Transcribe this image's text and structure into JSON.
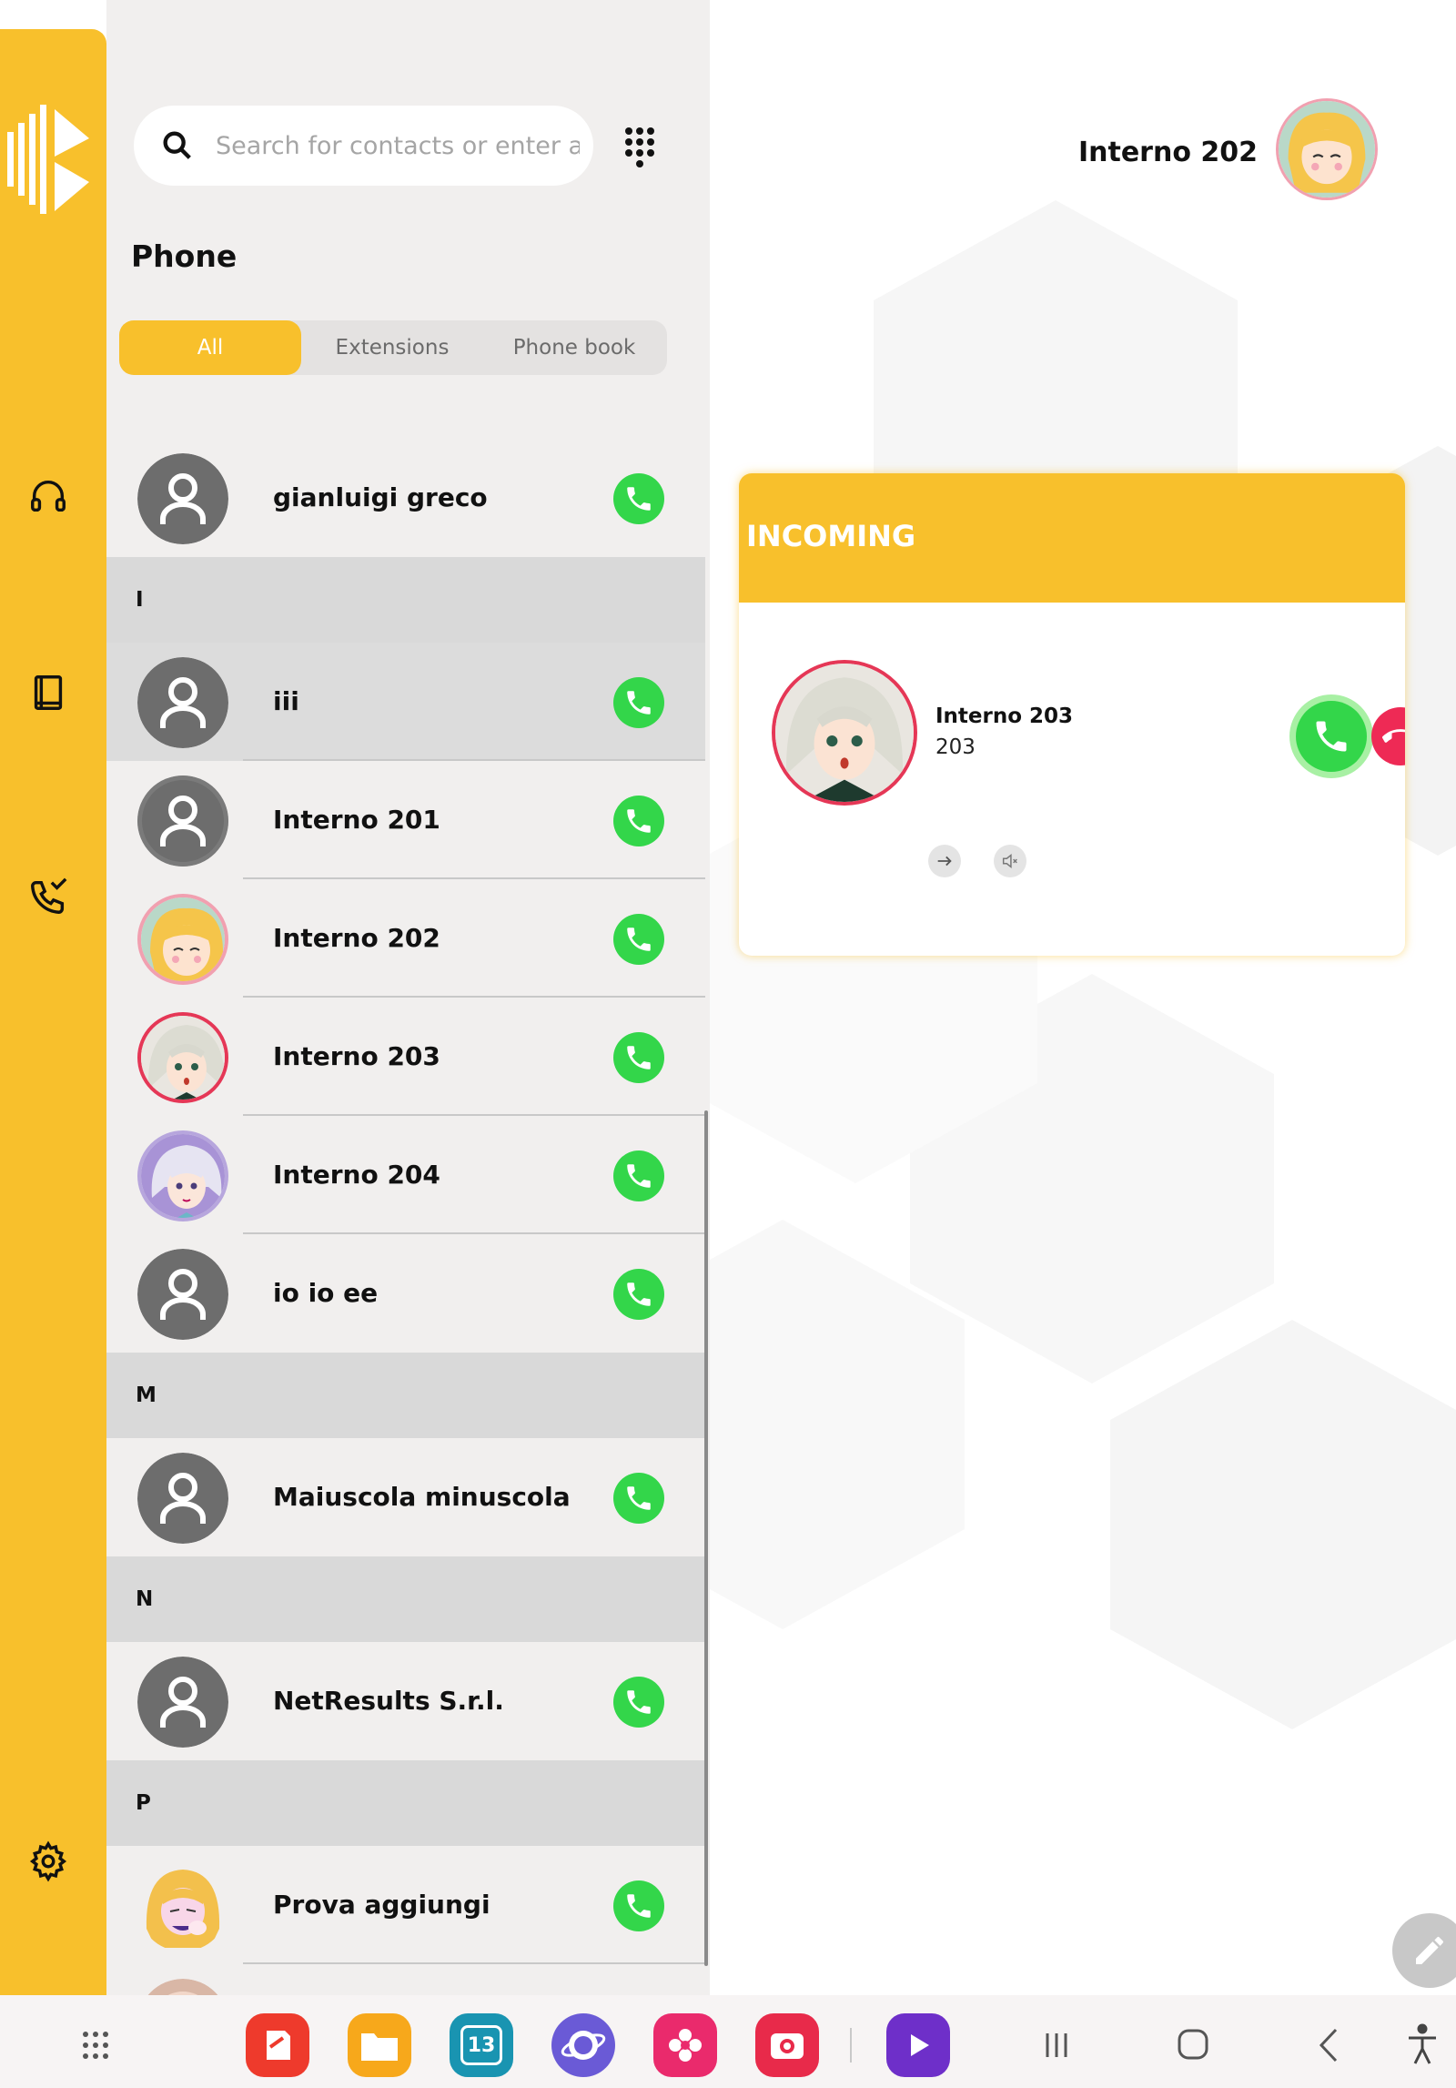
{
  "search": {
    "placeholder": "Search for contacts or enter a number"
  },
  "phone": {
    "title": "Phone"
  },
  "tabs": [
    {
      "label": "All",
      "active": true
    },
    {
      "label": "Extensions",
      "active": false
    },
    {
      "label": "Phone book",
      "active": false
    }
  ],
  "contacts": {
    "gianluigi": {
      "name": "gianluigi greco"
    },
    "section_i": "I",
    "iii": {
      "name": "iii"
    },
    "interno201": {
      "name": "Interno 201"
    },
    "interno202": {
      "name": "Interno 202"
    },
    "interno203": {
      "name": "Interno 203"
    },
    "interno204": {
      "name": "Interno 204"
    },
    "ioioee": {
      "name": "io io ee"
    },
    "section_m": "M",
    "maiuscola": {
      "name": "Maiuscola minuscola"
    },
    "section_n": "N",
    "netresults": {
      "name": "NetResults S.r.l."
    },
    "section_p": "P",
    "prova": {
      "name": "Prova aggiungi"
    }
  },
  "user": {
    "name": "Interno 202"
  },
  "incoming": {
    "title": "INCOMING",
    "caller_name": "Interno  203",
    "caller_number": "203"
  },
  "colors": {
    "accent": "#f8c02c",
    "call_green": "#33d64a",
    "decline_red": "#ee2a55",
    "panel_bg": "#f1efee"
  },
  "navbar": {
    "calendar_day": "13",
    "icons": [
      "apps-grid-icon",
      "notes-app-icon",
      "files-app-icon",
      "calendar-app-icon",
      "browser-app-icon",
      "gallery-app-icon",
      "camera-app-icon",
      "video-app-icon",
      "recents-icon",
      "home-icon",
      "back-icon",
      "accessibility-icon"
    ]
  }
}
